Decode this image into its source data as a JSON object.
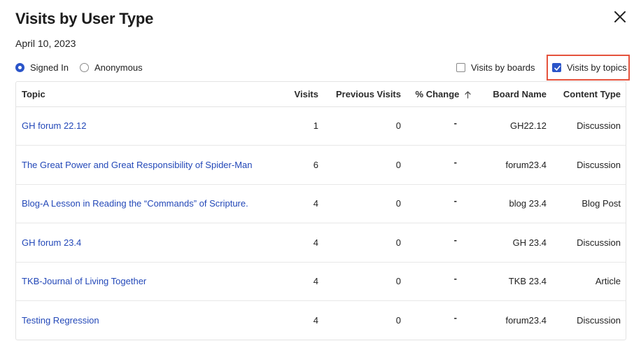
{
  "modal": {
    "title": "Visits by User Type",
    "date": "April 10, 2023"
  },
  "user_type": {
    "options": [
      {
        "label": "Signed In",
        "selected": true
      },
      {
        "label": "Anonymous",
        "selected": false
      }
    ]
  },
  "view_options": {
    "boards": {
      "label": "Visits by boards",
      "checked": false
    },
    "topics": {
      "label": "Visits by topics",
      "checked": true
    }
  },
  "table": {
    "headers": {
      "topic": "Topic",
      "visits": "Visits",
      "previous_visits": "Previous Visits",
      "change": "% Change",
      "board_name": "Board Name",
      "content_type": "Content Type"
    },
    "sort_icon": "arrow-up-icon",
    "rows": [
      {
        "topic": "GH forum 22.12",
        "visits": "1",
        "previous_visits": "0",
        "change": "-",
        "board_name": "GH22.12",
        "content_type": "Discussion"
      },
      {
        "topic": "The Great Power and Great Responsibility of Spider-Man",
        "visits": "6",
        "previous_visits": "0",
        "change": "-",
        "board_name": "forum23.4",
        "content_type": "Discussion"
      },
      {
        "topic": "Blog-A Lesson in Reading the “Commands” of Scripture.",
        "visits": "4",
        "previous_visits": "0",
        "change": "-",
        "board_name": "blog 23.4",
        "content_type": "Blog Post"
      },
      {
        "topic": "GH forum 23.4",
        "visits": "4",
        "previous_visits": "0",
        "change": "-",
        "board_name": "GH 23.4",
        "content_type": "Discussion"
      },
      {
        "topic": "TKB-Journal of Living Together",
        "visits": "4",
        "previous_visits": "0",
        "change": "-",
        "board_name": "TKB 23.4",
        "content_type": "Article"
      },
      {
        "topic": "Testing Regression",
        "visits": "4",
        "previous_visits": "0",
        "change": "-",
        "board_name": "forum23.4",
        "content_type": "Discussion"
      }
    ]
  },
  "colors": {
    "accent": "#2b55c9",
    "link": "#2348b8",
    "highlight": "#e5533d"
  }
}
